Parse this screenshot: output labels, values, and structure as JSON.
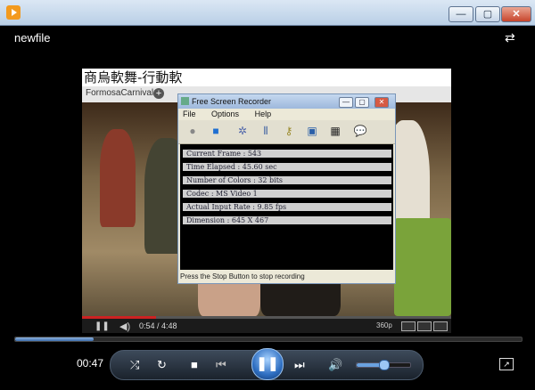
{
  "window": {
    "title": "",
    "buttons": {
      "minimize": "—",
      "maximize": "▢",
      "close": "✕"
    }
  },
  "viewer": {
    "file_title": "newfile",
    "switch_icon": "⇄"
  },
  "video": {
    "banner_text": "商烏軟舞-行動軟",
    "browser_tab": "FormosaCarnival",
    "tab_plus": "+",
    "player_time": "0:54 / 4:48",
    "quality": "360p",
    "progress_fraction": 0.2
  },
  "fsr": {
    "title": "Free Screen Recorder",
    "menu": [
      "File",
      "Options",
      "Help"
    ],
    "tools": [
      "record-icon",
      "stop-icon",
      "settings-icon",
      "split-icon",
      "key-icon",
      "monitor-icon",
      "film-icon",
      "help-icon"
    ],
    "stats": [
      "Current Frame : 543",
      "Time Elapsed : 45.60 sec",
      "Number of Colors : 32 bits",
      "Codec : MS Video 1",
      "Actual Input Rate : 9.85 fps",
      "Dimension : 645 X 467"
    ],
    "status": "Press the Stop Button to stop recording"
  },
  "controls": {
    "time": "00:47",
    "seek_fraction": 0.155,
    "volume_fraction": 0.5
  }
}
